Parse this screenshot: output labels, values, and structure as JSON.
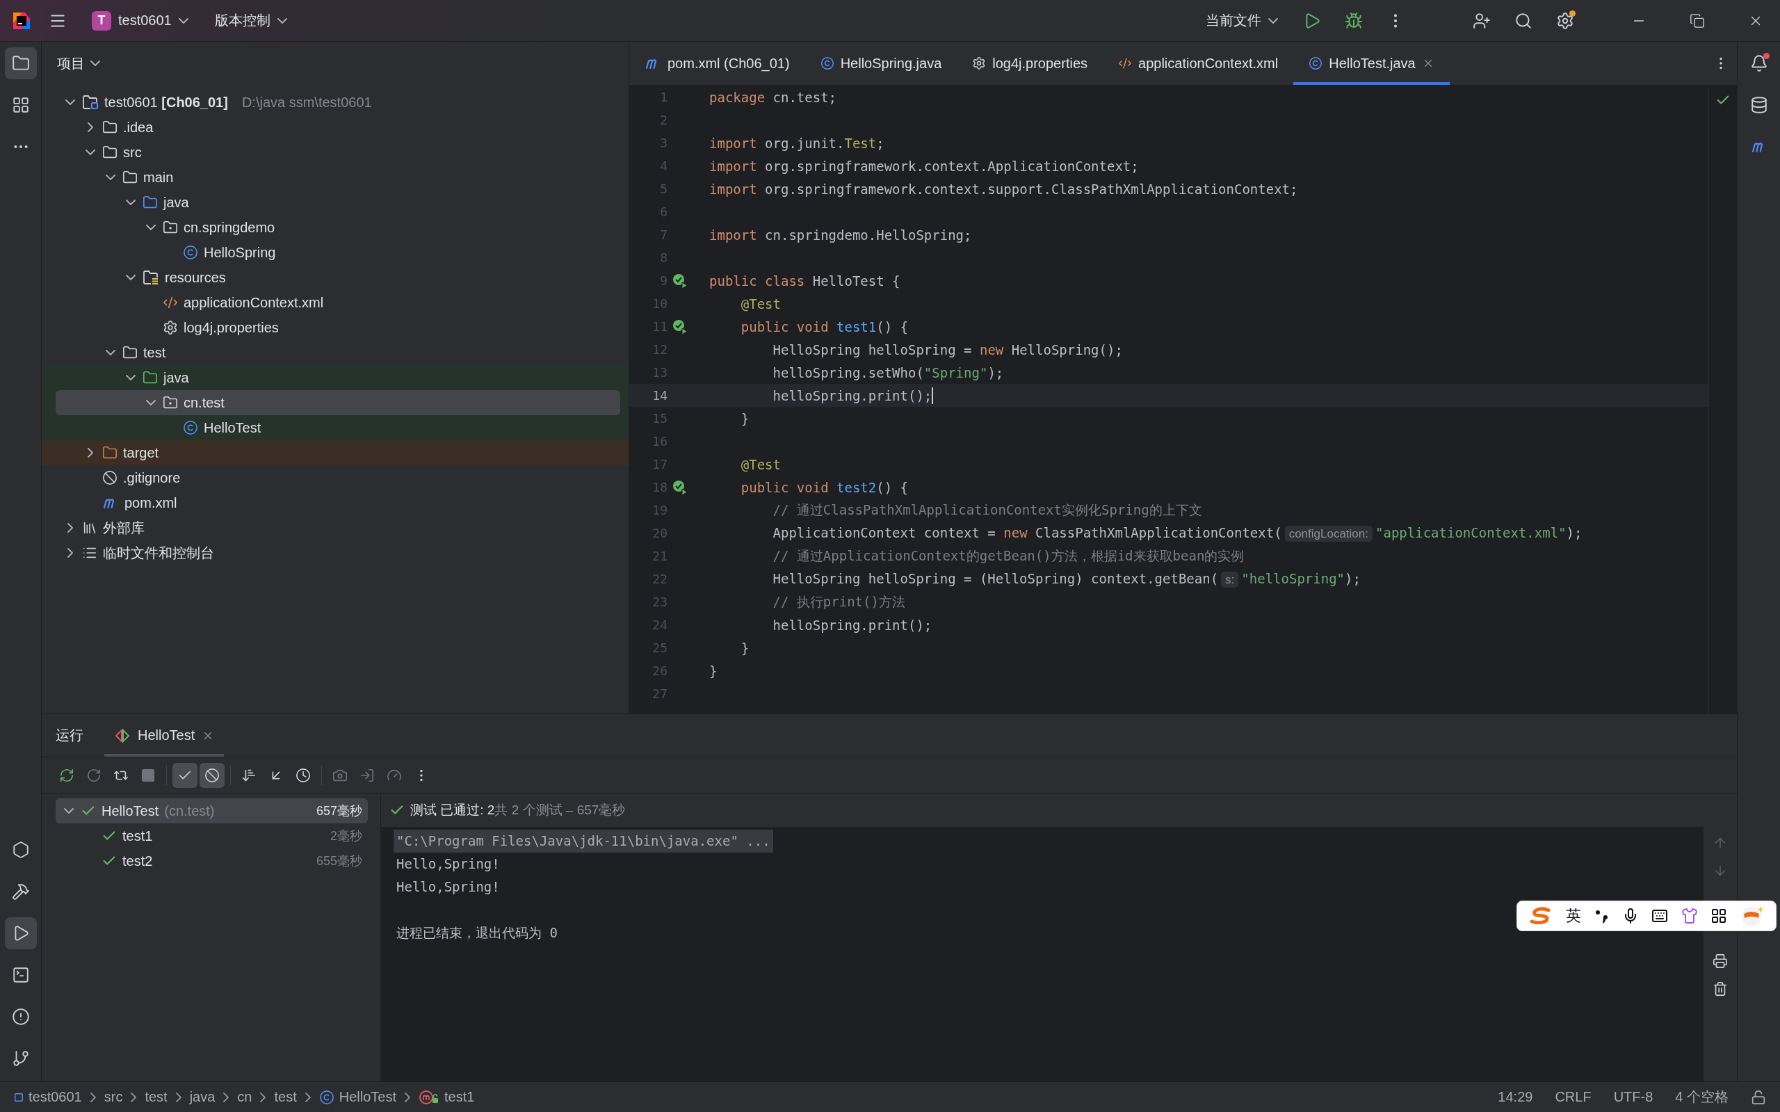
{
  "title_bar": {
    "project_badge": "T",
    "project": "test0601",
    "vcs": "版本控制",
    "run_config": "当前文件",
    "actions": [
      {
        "kind": "run"
      },
      {
        "kind": "debug"
      },
      {
        "kind": "more"
      },
      {
        "kind": "add-user"
      },
      {
        "kind": "search"
      },
      {
        "kind": "settings",
        "badge": true
      }
    ],
    "window_controls": [
      {
        "kind": "minimize"
      },
      {
        "kind": "maximize"
      },
      {
        "kind": "close"
      }
    ]
  },
  "left_tools_top": [
    {
      "kind": "project",
      "selected": true
    },
    {
      "kind": "structure",
      "selected": false
    },
    {
      "kind": "more",
      "selected": false
    }
  ],
  "left_tools_bottom": [
    {
      "kind": "services",
      "selected": false
    },
    {
      "kind": "build",
      "selected": false
    },
    {
      "kind": "run",
      "selected": true
    },
    {
      "kind": "terminal",
      "selected": false
    },
    {
      "kind": "problems",
      "selected": false
    },
    {
      "kind": "git",
      "selected": false
    }
  ],
  "project_panel": {
    "title": "项目",
    "tree": [
      {
        "name": "test0601 **[Ch06_01]**",
        "hint": "D:\\java ssm\\test0601",
        "kind": "module",
        "expanded": true,
        "selected": false,
        "test_scope": false,
        "children": [
          {
            "name": ".idea",
            "kind": "folder",
            "expanded": false,
            "selected": false,
            "test_scope": false
          },
          {
            "name": "src",
            "kind": "folder",
            "expanded": true,
            "selected": false,
            "test_scope": false,
            "children": [
              {
                "name": "main",
                "kind": "folder",
                "expanded": true,
                "selected": false,
                "test_scope": false,
                "children": [
                  {
                    "name": "java",
                    "kind": "source-root",
                    "expanded": true,
                    "selected": false,
                    "test_scope": false,
                    "children": [
                      {
                        "name": "cn.springdemo",
                        "kind": "package",
                        "expanded": true,
                        "selected": false,
                        "test_scope": false,
                        "children": [
                          {
                            "name": "HelloSpring",
                            "kind": "class",
                            "selected": false,
                            "test_scope": false
                          }
                        ]
                      }
                    ]
                  },
                  {
                    "name": "resources",
                    "kind": "resources",
                    "expanded": true,
                    "selected": false,
                    "test_scope": false,
                    "children": [
                      {
                        "name": "applicationContext.xml",
                        "kind": "xml",
                        "selected": false,
                        "test_scope": false
                      },
                      {
                        "name": "log4j.properties",
                        "kind": "properties",
                        "selected": false,
                        "test_scope": false
                      }
                    ]
                  }
                ]
              },
              {
                "name": "test",
                "kind": "folder",
                "expanded": true,
                "selected": false,
                "test_scope": false,
                "children": [
                  {
                    "name": "java",
                    "kind": "test-root",
                    "expanded": true,
                    "selected": false,
                    "test_scope": true,
                    "children": [
                      {
                        "name": "cn.test",
                        "kind": "package",
                        "expanded": true,
                        "selected": true,
                        "test_scope": true,
                        "children": [
                          {
                            "name": "HelloTest",
                            "kind": "class",
                            "selected": false,
                            "test_scope": true
                          }
                        ]
                      }
                    ]
                  }
                ]
              }
            ]
          },
          {
            "name": "target",
            "kind": "excluded",
            "expanded": false,
            "selected": false,
            "test_scope": false
          },
          {
            "name": ".gitignore",
            "kind": "ignore",
            "selected": false,
            "test_scope": false
          },
          {
            "name": "pom.xml",
            "kind": "maven",
            "selected": false,
            "test_scope": false
          }
        ]
      },
      {
        "name": "外部库",
        "kind": "libraries",
        "expanded": false,
        "selected": false,
        "test_scope": false
      },
      {
        "name": "临时文件和控制台",
        "kind": "scratches",
        "expanded": false,
        "selected": false,
        "test_scope": false
      }
    ]
  },
  "editor": {
    "tabs": [
      {
        "label": "pom.xml (Ch06_01)",
        "kind": "maven",
        "selected": false
      },
      {
        "label": "HelloSpring.java",
        "kind": "class",
        "selected": false
      },
      {
        "label": "log4j.properties",
        "kind": "properties",
        "selected": false
      },
      {
        "label": "applicationContext.xml",
        "kind": "xml",
        "selected": false
      },
      {
        "label": "HelloTest.java",
        "kind": "class",
        "selected": true
      }
    ],
    "no_problems": true,
    "lines": [
      {
        "number": "1",
        "segments": [
          {
            "kind": "kw",
            "text": "package"
          },
          {
            "kind": "plain",
            "text": " cn.test;"
          }
        ]
      },
      {
        "number": "2"
      },
      {
        "number": "3",
        "segments": [
          {
            "kind": "kw",
            "text": "import"
          },
          {
            "kind": "plain",
            "text": " org.junit."
          },
          {
            "kind": "ann",
            "text": "Test"
          },
          {
            "kind": "plain",
            "text": ";"
          }
        ]
      },
      {
        "number": "4",
        "segments": [
          {
            "kind": "kw",
            "text": "import"
          },
          {
            "kind": "plain",
            "text": " org.springframework.context.ApplicationContext;"
          }
        ]
      },
      {
        "number": "5",
        "segments": [
          {
            "kind": "kw",
            "text": "import"
          },
          {
            "kind": "plain",
            "text": " org.springframework.context.support.ClassPathXmlApplicationContext;"
          }
        ]
      },
      {
        "number": "6"
      },
      {
        "number": "7",
        "segments": [
          {
            "kind": "kw",
            "text": "import"
          },
          {
            "kind": "plain",
            "text": " cn.springdemo.HelloSpring;"
          }
        ]
      },
      {
        "number": "8"
      },
      {
        "number": "9",
        "run": true,
        "segments": [
          {
            "kind": "kw",
            "text": "public class"
          },
          {
            "kind": "plain",
            "text": " HelloTest {"
          }
        ]
      },
      {
        "number": "10",
        "segments": [
          {
            "kind": "ann",
            "text": "    @Test"
          }
        ]
      },
      {
        "number": "11",
        "run": true,
        "segments": [
          {
            "kind": "kw",
            "text": "    public void"
          },
          {
            "kind": "fn",
            "text": " test1"
          },
          {
            "kind": "plain",
            "text": "() {"
          }
        ]
      },
      {
        "number": "12",
        "segments": [
          {
            "kind": "plain",
            "text": "        HelloSpring helloSpring = "
          },
          {
            "kind": "kw",
            "text": "new"
          },
          {
            "kind": "plain",
            "text": " HelloSpring();"
          }
        ]
      },
      {
        "number": "13",
        "segments": [
          {
            "kind": "plain",
            "text": "        helloSpring.setWho("
          },
          {
            "kind": "str",
            "text": "\"Spring\""
          },
          {
            "kind": "plain",
            "text": ");"
          }
        ]
      },
      {
        "number": "14",
        "current": true,
        "segments": [
          {
            "kind": "plain",
            "text": "        helloSpring.print();"
          }
        ]
      },
      {
        "number": "15",
        "segments": [
          {
            "kind": "plain",
            "text": "    }"
          }
        ]
      },
      {
        "number": "16"
      },
      {
        "number": "17",
        "segments": [
          {
            "kind": "ann",
            "text": "    @Test"
          }
        ]
      },
      {
        "number": "18",
        "run": true,
        "segments": [
          {
            "kind": "kw",
            "text": "    public void"
          },
          {
            "kind": "fn",
            "text": " test2"
          },
          {
            "kind": "plain",
            "text": "() {"
          }
        ]
      },
      {
        "number": "19",
        "segments": [
          {
            "kind": "cmt",
            "text": "        // 通过ClassPathXmlApplicationContext实例化Spring的上下文"
          }
        ]
      },
      {
        "number": "20",
        "segments": [
          {
            "kind": "plain",
            "text": "        ApplicationContext context = "
          },
          {
            "kind": "kw",
            "text": "new"
          },
          {
            "kind": "plain",
            "text": " ClassPathXmlApplicationContext("
          },
          {
            "kind": "hint",
            "text": "configLocation:"
          },
          {
            "kind": "str",
            "text": "\"applicationContext.xml\""
          },
          {
            "kind": "plain",
            "text": ");"
          }
        ]
      },
      {
        "number": "21",
        "segments": [
          {
            "kind": "cmt",
            "text": "        // 通过ApplicationContext的getBean()方法，根据id来获取bean的实例"
          }
        ]
      },
      {
        "number": "22",
        "segments": [
          {
            "kind": "plain",
            "text": "        HelloSpring helloSpring = (HelloSpring) context.getBean("
          },
          {
            "kind": "hint",
            "text": "s:"
          },
          {
            "kind": "str",
            "text": "\"helloSpring\""
          },
          {
            "kind": "plain",
            "text": ");"
          }
        ]
      },
      {
        "number": "23",
        "segments": [
          {
            "kind": "cmt",
            "text": "        // 执行print()方法"
          }
        ]
      },
      {
        "number": "24",
        "segments": [
          {
            "kind": "plain",
            "text": "        helloSpring.print();"
          }
        ]
      },
      {
        "number": "25",
        "segments": [
          {
            "kind": "plain",
            "text": "    }"
          }
        ]
      },
      {
        "number": "26",
        "segments": [
          {
            "kind": "plain",
            "text": "}"
          }
        ]
      },
      {
        "number": "27"
      }
    ]
  },
  "right_tools": [
    {
      "kind": "notifications",
      "badge": true
    },
    {
      "kind": "database"
    },
    {
      "kind": "maven"
    }
  ],
  "run_panel": {
    "title": "运行",
    "tabs": [
      {
        "label": "HelloTest",
        "selected": true
      }
    ],
    "toolbar": [
      {
        "kind": "rerun",
        "on": false,
        "disabled": false
      },
      {
        "kind": "rerun-failed",
        "on": false,
        "disabled": true
      },
      {
        "kind": "auto-test",
        "on": false,
        "disabled": false
      },
      {
        "kind": "stop",
        "on": false,
        "disabled": true
      },
      {
        "kind": "separator"
      },
      {
        "kind": "show-passed",
        "on": true,
        "disabled": false
      },
      {
        "kind": "show-ignored",
        "on": true,
        "disabled": false
      },
      {
        "kind": "separator"
      },
      {
        "kind": "sort",
        "on": false,
        "disabled": false
      },
      {
        "kind": "collapse",
        "on": false,
        "disabled": false
      },
      {
        "kind": "history",
        "on": false,
        "disabled": false
      },
      {
        "kind": "separator"
      },
      {
        "kind": "screenshot",
        "on": false,
        "disabled": true
      },
      {
        "kind": "import",
        "on": false,
        "disabled": true
      },
      {
        "kind": "coverage",
        "on": false,
        "disabled": true
      },
      {
        "kind": "more",
        "on": false,
        "disabled": false
      }
    ],
    "tests": [
      {
        "name": "HelloTest",
        "package": "(cn.test)",
        "time": "657毫秒",
        "passed": true,
        "expanded": true,
        "selected": true,
        "children": [
          {
            "name": "test1",
            "time": "2毫秒",
            "passed": true,
            "selected": false
          },
          {
            "name": "test2",
            "time": "655毫秒",
            "passed": true,
            "selected": false
          }
        ]
      }
    ],
    "result": {
      "passed": true,
      "label": "测试 已通过: 2",
      "summary": "共 2 个测试 – 657毫秒"
    },
    "console": [
      {
        "kind": "command",
        "text": "\"C:\\Program Files\\Java\\jdk-11\\bin\\java.exe\" ..."
      },
      {
        "kind": "output",
        "text": "Hello,Spring!"
      },
      {
        "kind": "output",
        "text": "Hello,Spring!"
      },
      {
        "kind": "exit",
        "text": "进程已结束，退出代码为 0"
      }
    ],
    "console_actions": [
      {
        "kind": "up",
        "disabled": true
      },
      {
        "kind": "down",
        "disabled": true
      },
      {
        "kind": "print",
        "disabled": false
      },
      {
        "kind": "clear",
        "disabled": false
      }
    ]
  },
  "ime_toolbar": {
    "mode": "英"
  },
  "status_bar": {
    "breadcrumbs": [
      {
        "kind": "module",
        "label": "test0601"
      },
      {
        "kind": "folder",
        "label": "src"
      },
      {
        "kind": "folder",
        "label": "test"
      },
      {
        "kind": "folder",
        "label": "java"
      },
      {
        "kind": "folder",
        "label": "cn"
      },
      {
        "kind": "folder",
        "label": "test"
      },
      {
        "kind": "class",
        "label": "HelloTest"
      },
      {
        "kind": "method",
        "label": "test1"
      }
    ],
    "position": "14:29",
    "line_separator": "CRLF",
    "encoding": "UTF-8",
    "indent": "4 个空格",
    "read_only": false
  }
}
